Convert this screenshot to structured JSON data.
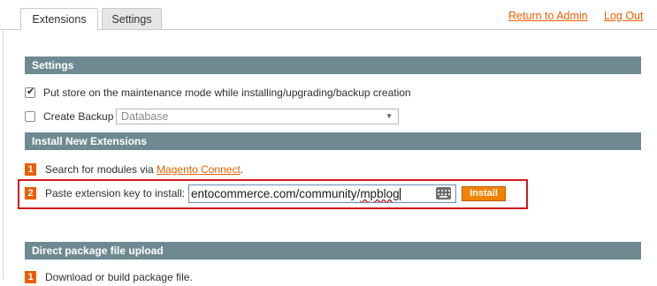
{
  "tabs": [
    {
      "label": "Extensions",
      "active": true
    },
    {
      "label": "Settings",
      "active": false
    }
  ],
  "header_links": {
    "return_admin": "Return to Admin",
    "logout": "Log Out"
  },
  "settings": {
    "title": "Settings",
    "maintenance_label": "Put store on the maintenance mode while installing/upgrading/backup creation",
    "maintenance_checked": true,
    "backup_label": "Create Backup",
    "backup_checked": false,
    "backup_type_value": "Database"
  },
  "install": {
    "title": "Install New Extensions",
    "step1_num": "1",
    "step1_text": "Search for modules via ",
    "step1_link": "Magento Connect",
    "step1_suffix": ".",
    "step2_num": "2",
    "step2_label": "Paste extension key to install:",
    "key_prefix": "entocommerce.com/community/",
    "key_underlined": "mpblog",
    "install_button": "Install"
  },
  "upload": {
    "title": "Direct package file upload",
    "step1_num": "1",
    "step1_text": "Download or build package file."
  },
  "colors": {
    "accent": "#eb5e00",
    "section_header": "#6f8992",
    "highlight": "#d11a1a"
  }
}
